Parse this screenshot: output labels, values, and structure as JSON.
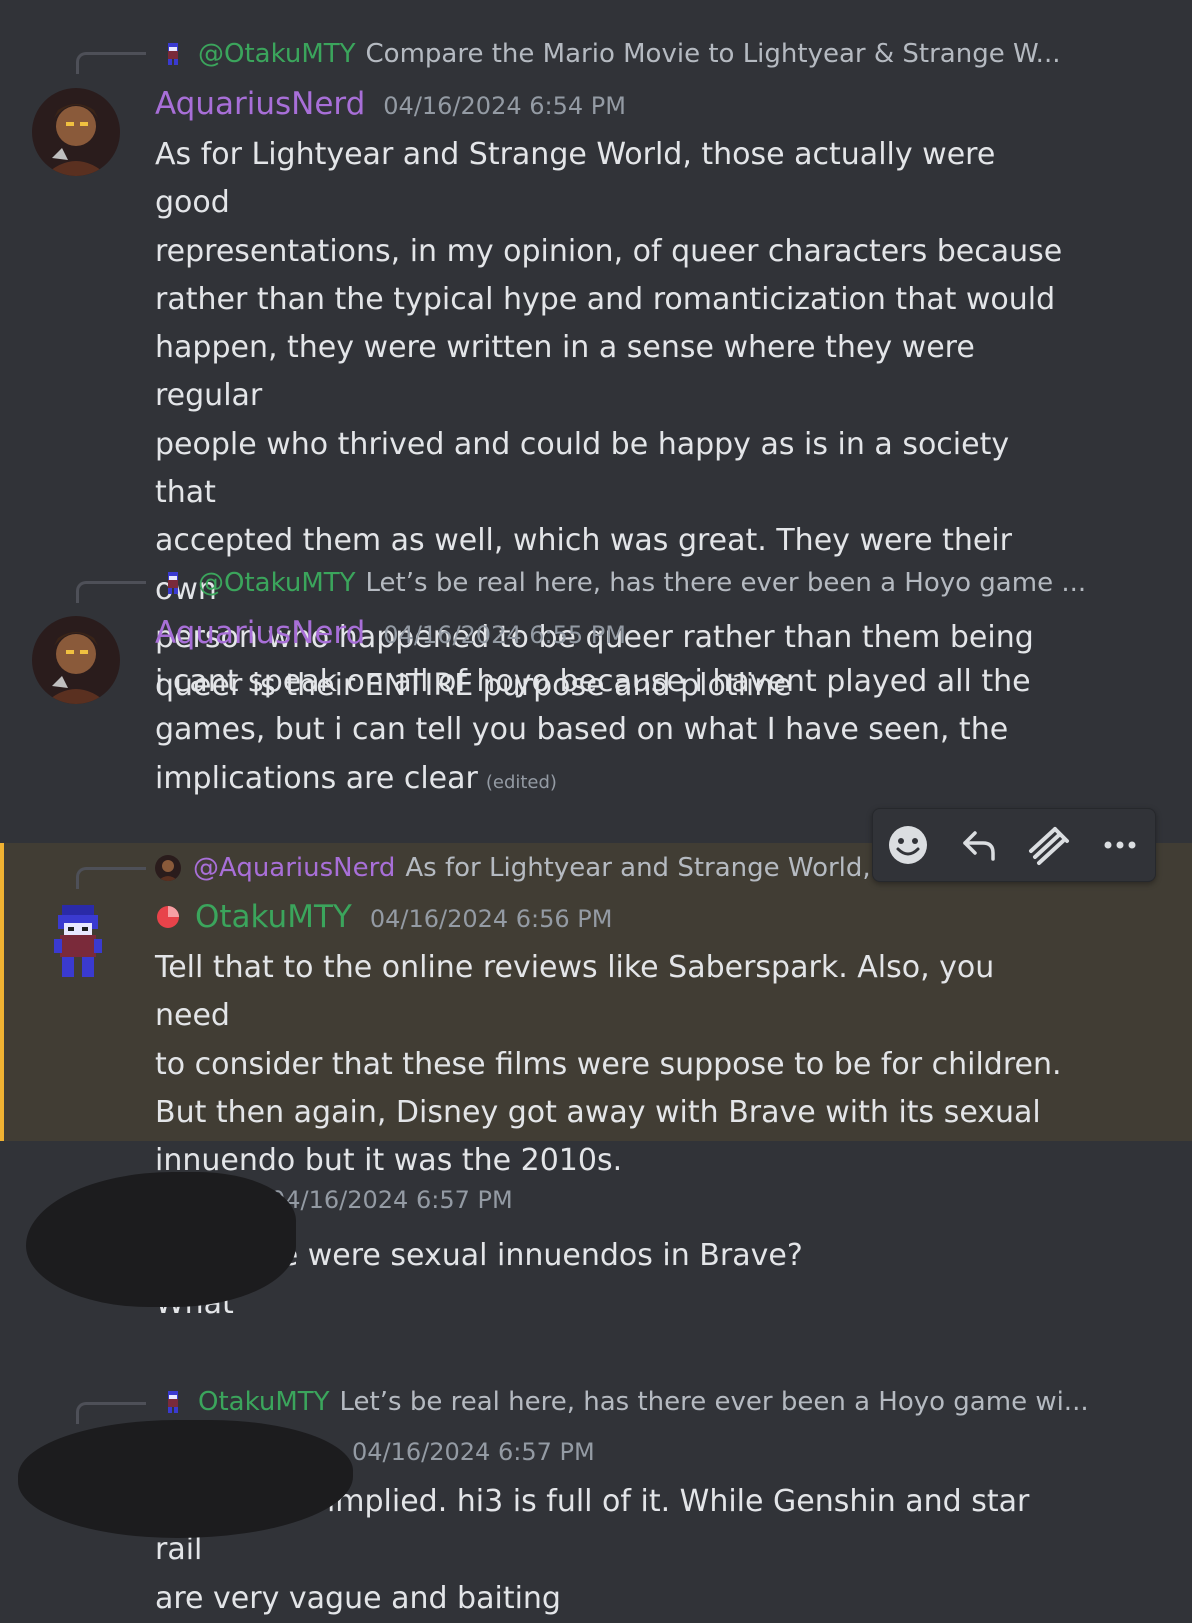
{
  "colors": {
    "background": "#313338",
    "highlight_bg": "#413d34",
    "highlight_bar": "#f0b232",
    "aquarius_name": "#a86fd8",
    "otaku_name": "#3ba55c",
    "timestamp": "#949ba4",
    "body_text": "#e3e5e8"
  },
  "messages": [
    {
      "reply": {
        "icon": "pixel-character-icon",
        "mention": "@OtakuMTY",
        "snippet": "Compare the Mario Movie to Lightyear & Strange W..."
      },
      "avatar": "aquariusnerd-avatar",
      "author": "AquariusNerd",
      "timestamp": "04/16/2024 6:54 PM",
      "lines": [
        "As for Lightyear and Strange World, those actually were good",
        "representations, in my opinion, of queer characters because",
        "rather than the typical hype and romanticization that would",
        "happen, they were written in a sense where they were regular",
        "people who thrived and could be happy as is in a society that",
        "accepted them as well, which was great. They were their own",
        "person who happened to be queer rather than them being",
        "queer is their ENTIRE purpose and plotline"
      ]
    },
    {
      "reply": {
        "icon": "pixel-character-icon",
        "mention": "@OtakuMTY",
        "snippet": "Let’s be real here, has there ever been a Hoyo game ..."
      },
      "avatar": "aquariusnerd-avatar",
      "author": "AquariusNerd",
      "timestamp": "04/16/2024 6:55 PM",
      "lines": [
        "i cant speak on all of hoyo because i havent played all the",
        "games, but i can tell you based on what I have seen, the",
        "implications are clear"
      ],
      "edited": "(edited)"
    },
    {
      "reply": {
        "icon": "aquariusnerd-mini-avatar",
        "mention": "@AquariusNerd",
        "snippet": "As for Lightyear and Strange World,"
      },
      "avatar": "pixel-character-avatar",
      "role_icon": "red-role-icon",
      "author": "OtakuMTY",
      "timestamp": "04/16/2024 6:56 PM",
      "lines": [
        "Tell that to the online reviews like Saberspark. Also, you need",
        "to consider that these films were suppose to be for children.",
        "But then again, Disney got away with Brave with its sexual",
        "innuendo but it was the 2010s."
      ]
    },
    {
      "timestamp": "04/16/2024 6:57 PM",
      "timestamp_visible": "4/16/2024 6:57 PM",
      "lines": [
        "??? There were sexual innuendos in Brave?",
        "What"
      ]
    },
    {
      "reply": {
        "icon": "pixel-character-icon",
        "mention": "OtakuMTY",
        "snippet": "Let’s be real here, has there ever been a Hoyo game wi..."
      },
      "timestamp": "04/16/2024 6:57 PM",
      "lines": [
        "yes, highly implied. hi3 is full of it. While Genshin and star rail",
        "are very vague and baiting"
      ]
    }
  ],
  "toolbar": {
    "buttons": [
      "add-reaction-icon",
      "reply-icon",
      "forward-icon",
      "more-icon"
    ]
  }
}
